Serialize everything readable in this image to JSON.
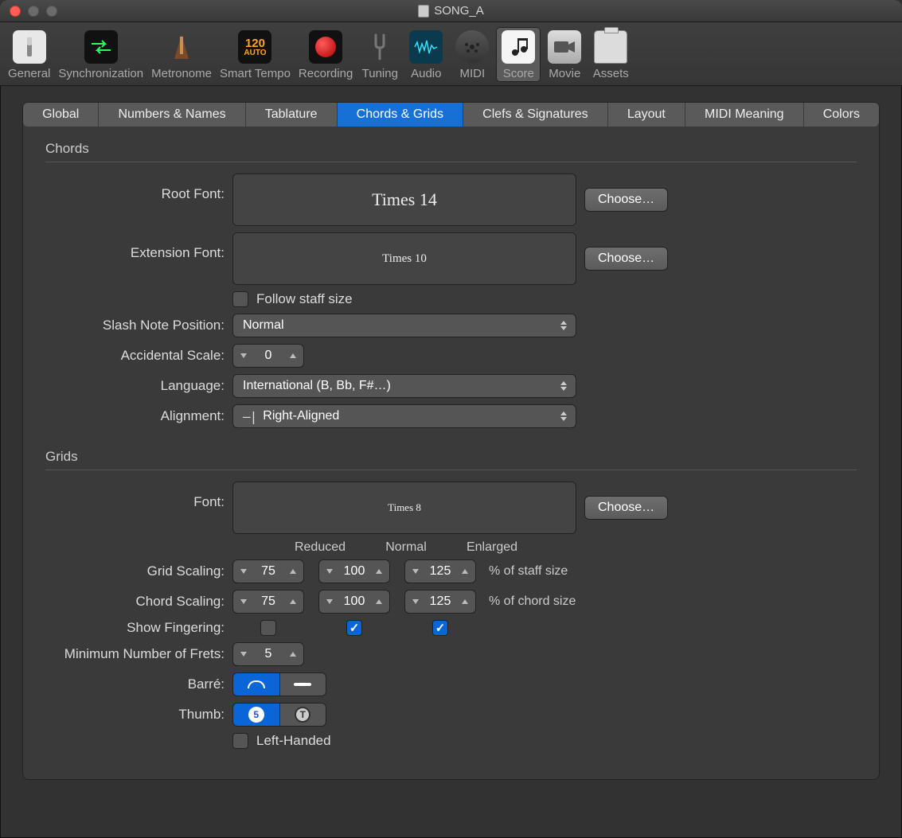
{
  "window": {
    "title": "SONG_A"
  },
  "toolbar": {
    "items": [
      {
        "label": "General"
      },
      {
        "label": "Synchronization"
      },
      {
        "label": "Metronome"
      },
      {
        "label": "Smart Tempo",
        "badge": "120",
        "badge2": "AUTO"
      },
      {
        "label": "Recording"
      },
      {
        "label": "Tuning"
      },
      {
        "label": "Audio"
      },
      {
        "label": "MIDI"
      },
      {
        "label": "Score"
      },
      {
        "label": "Movie"
      },
      {
        "label": "Assets"
      }
    ]
  },
  "subtabs": [
    {
      "label": "Global"
    },
    {
      "label": "Numbers & Names"
    },
    {
      "label": "Tablature"
    },
    {
      "label": "Chords & Grids"
    },
    {
      "label": "Clefs & Signatures"
    },
    {
      "label": "Layout"
    },
    {
      "label": "MIDI Meaning"
    },
    {
      "label": "Colors"
    }
  ],
  "chords": {
    "section": "Chords",
    "root_font_label": "Root Font:",
    "root_font_value": "Times 14",
    "choose": "Choose…",
    "ext_font_label": "Extension Font:",
    "ext_font_value": "Times 10",
    "follow_staff_label": "Follow staff size",
    "follow_staff_checked": false,
    "slash_label": "Slash Note Position:",
    "slash_value": "Normal",
    "accidental_label": "Accidental Scale:",
    "accidental_value": "0",
    "language_label": "Language:",
    "language_value": "International (B, Bb, F#…)",
    "alignment_label": "Alignment:",
    "alignment_glyph": "–|",
    "alignment_value": "Right-Aligned"
  },
  "grids": {
    "section": "Grids",
    "font_label": "Font:",
    "font_value": "Times 8",
    "choose": "Choose…",
    "col_reduced": "Reduced",
    "col_normal": "Normal",
    "col_enlarged": "Enlarged",
    "grid_scaling_label": "Grid Scaling:",
    "grid_scaling_reduced": "75",
    "grid_scaling_normal": "100",
    "grid_scaling_enlarged": "125",
    "grid_unit": "% of staff size",
    "chord_scaling_label": "Chord Scaling:",
    "chord_scaling_reduced": "75",
    "chord_scaling_normal": "100",
    "chord_scaling_enlarged": "125",
    "chord_unit": "% of chord size",
    "show_fingering_label": "Show Fingering:",
    "show_fingering_reduced": false,
    "show_fingering_normal": true,
    "show_fingering_enlarged": true,
    "min_frets_label": "Minimum Number of Frets:",
    "min_frets_value": "5",
    "barre_label": "Barré:",
    "thumb_label": "Thumb:",
    "thumb_num": "5",
    "thumb_t": "T",
    "left_handed_label": "Left-Handed",
    "left_handed_checked": false
  }
}
